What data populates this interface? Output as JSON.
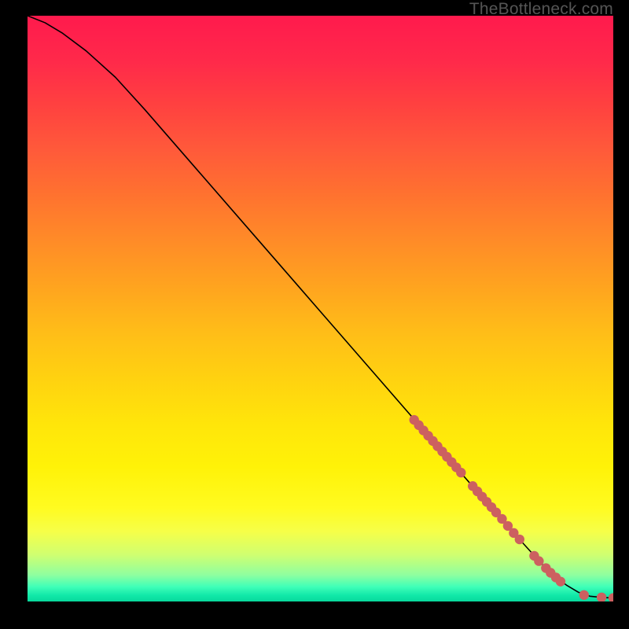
{
  "watermark": "TheBottleneck.com",
  "chart_data": {
    "type": "line",
    "title": "",
    "xlabel": "",
    "ylabel": "",
    "xlim": [
      0,
      100
    ],
    "ylim": [
      0,
      100
    ],
    "series": [
      {
        "name": "curve",
        "x": [
          0,
          3,
          6,
          10,
          15,
          20,
          30,
          40,
          50,
          60,
          70,
          75,
          80,
          85,
          88,
          90,
          92,
          94,
          96,
          98,
          100
        ],
        "y": [
          100,
          98.8,
          97,
          94,
          89.5,
          84,
          72.5,
          61,
          49.5,
          38,
          26.5,
          20.8,
          15,
          9.5,
          6.2,
          4.3,
          2.8,
          1.6,
          0.9,
          0.7,
          0.6
        ]
      }
    ],
    "markers": [
      {
        "x": 66.0,
        "y": 31.0
      },
      {
        "x": 66.8,
        "y": 30.1
      },
      {
        "x": 67.6,
        "y": 29.2
      },
      {
        "x": 68.4,
        "y": 28.3
      },
      {
        "x": 69.2,
        "y": 27.4
      },
      {
        "x": 70.0,
        "y": 26.5
      },
      {
        "x": 70.8,
        "y": 25.6
      },
      {
        "x": 71.6,
        "y": 24.7
      },
      {
        "x": 72.4,
        "y": 23.8
      },
      {
        "x": 73.2,
        "y": 22.9
      },
      {
        "x": 74.0,
        "y": 22.0
      },
      {
        "x": 76.0,
        "y": 19.7
      },
      {
        "x": 76.8,
        "y": 18.8
      },
      {
        "x": 77.6,
        "y": 17.9
      },
      {
        "x": 78.4,
        "y": 17.0
      },
      {
        "x": 79.2,
        "y": 16.1
      },
      {
        "x": 80.0,
        "y": 15.2
      },
      {
        "x": 81.0,
        "y": 14.1
      },
      {
        "x": 82.0,
        "y": 12.9
      },
      {
        "x": 83.0,
        "y": 11.7
      },
      {
        "x": 84.0,
        "y": 10.6
      },
      {
        "x": 86.5,
        "y": 7.8
      },
      {
        "x": 87.3,
        "y": 6.9
      },
      {
        "x": 88.5,
        "y": 5.7
      },
      {
        "x": 89.3,
        "y": 4.9
      },
      {
        "x": 90.2,
        "y": 4.1
      },
      {
        "x": 91.0,
        "y": 3.4
      },
      {
        "x": 95.0,
        "y": 1.1
      },
      {
        "x": 98.0,
        "y": 0.7
      },
      {
        "x": 100.0,
        "y": 0.6
      }
    ],
    "marker_color": "#cc6060",
    "line_color": "#000000"
  }
}
